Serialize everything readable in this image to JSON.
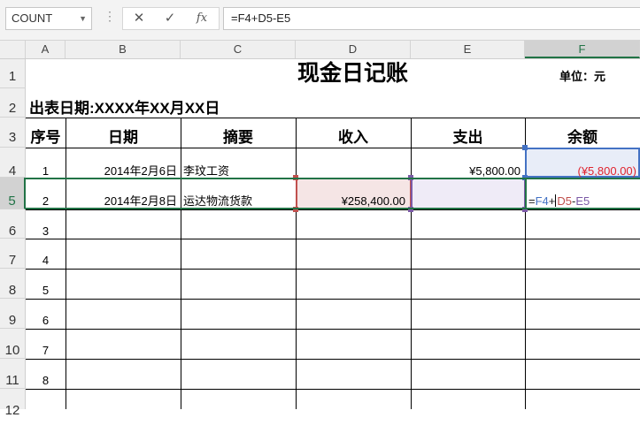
{
  "formula_bar": {
    "name_box": "COUNT",
    "cancel_icon": "✕",
    "enter_icon": "✓",
    "fx_icon": "fx",
    "formula": "=F4+D5-E5"
  },
  "columns": [
    "A",
    "B",
    "C",
    "D",
    "E",
    "F"
  ],
  "rows": [
    "1",
    "2",
    "3",
    "4",
    "5",
    "6",
    "7",
    "8",
    "9",
    "10",
    "11",
    "12"
  ],
  "sheet": {
    "title": "现金日记账",
    "unit": "单位：元",
    "date_line": "出表日期:XXXX年XX月XX日",
    "headers": [
      "序号",
      "日期",
      "摘要",
      "收入",
      "支出",
      "余额"
    ],
    "entries": [
      {
        "no": "1",
        "date": "2014年2月6日",
        "summary": "李玟工资",
        "income": "",
        "expense": "¥5,800.00",
        "balance": "(¥5,800.00)"
      },
      {
        "no": "2",
        "date": "2014年2月8日",
        "summary": "运达物流货款",
        "income": "¥258,400.00",
        "expense": "",
        "balance": ""
      }
    ],
    "editing_formula": {
      "eq": "=",
      "ref1": "F4",
      "op1": "+",
      "ref2": "D5",
      "op2": "-",
      "ref3": "E5"
    },
    "row_numbers": [
      "3",
      "4",
      "5",
      "6",
      "7",
      "8"
    ]
  },
  "colors": {
    "ref_f4": "#4472c4",
    "ref_d5": "#c0504d",
    "ref_e5": "#7b5aa6",
    "active_green": "#217346",
    "negative": "#e0242f"
  }
}
